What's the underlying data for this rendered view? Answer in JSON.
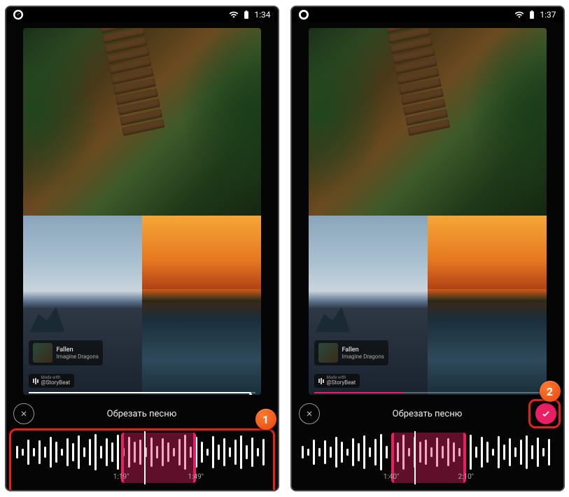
{
  "screens": [
    {
      "statusbar": {
        "time": "1:34"
      },
      "track": {
        "title": "Fallen",
        "artist": "Imagine Dragons"
      },
      "watermark": {
        "prefix": "Made with",
        "handle": "@StoryBeat"
      },
      "progress_pct": 98,
      "trim": {
        "title": "Обрезать песню",
        "selection_start_pct": 42,
        "selection_end_pct": 71,
        "playhead_pct": 51,
        "time_start": "1:19\"",
        "time_end": "1:49\"",
        "show_confirm": false
      },
      "callout": {
        "target": "waveform",
        "badge": "1"
      }
    },
    {
      "statusbar": {
        "time": "1:37"
      },
      "track": {
        "title": "Fallen",
        "artist": "Imagine Dragons"
      },
      "watermark": {
        "prefix": "Made with",
        "handle": "@StoryBeat"
      },
      "progress_pct": 39,
      "trim": {
        "title": "Обрезать песню",
        "selection_start_pct": 36,
        "selection_end_pct": 65,
        "playhead_pct": 45,
        "time_start": "1:40\"",
        "time_end": "2:10\"",
        "show_confirm": true
      },
      "callout": {
        "target": "confirm",
        "badge": "2"
      }
    }
  ],
  "waveform_heights": [
    18,
    10,
    36,
    12,
    34,
    16,
    44,
    30,
    10,
    40,
    26,
    48,
    14,
    38,
    52,
    18,
    40,
    28,
    50,
    12,
    44,
    30,
    36,
    14,
    42,
    18,
    40,
    28,
    12,
    38,
    50,
    16,
    44,
    30,
    10,
    46,
    22,
    40,
    14,
    36,
    48,
    20,
    42,
    12,
    38
  ]
}
